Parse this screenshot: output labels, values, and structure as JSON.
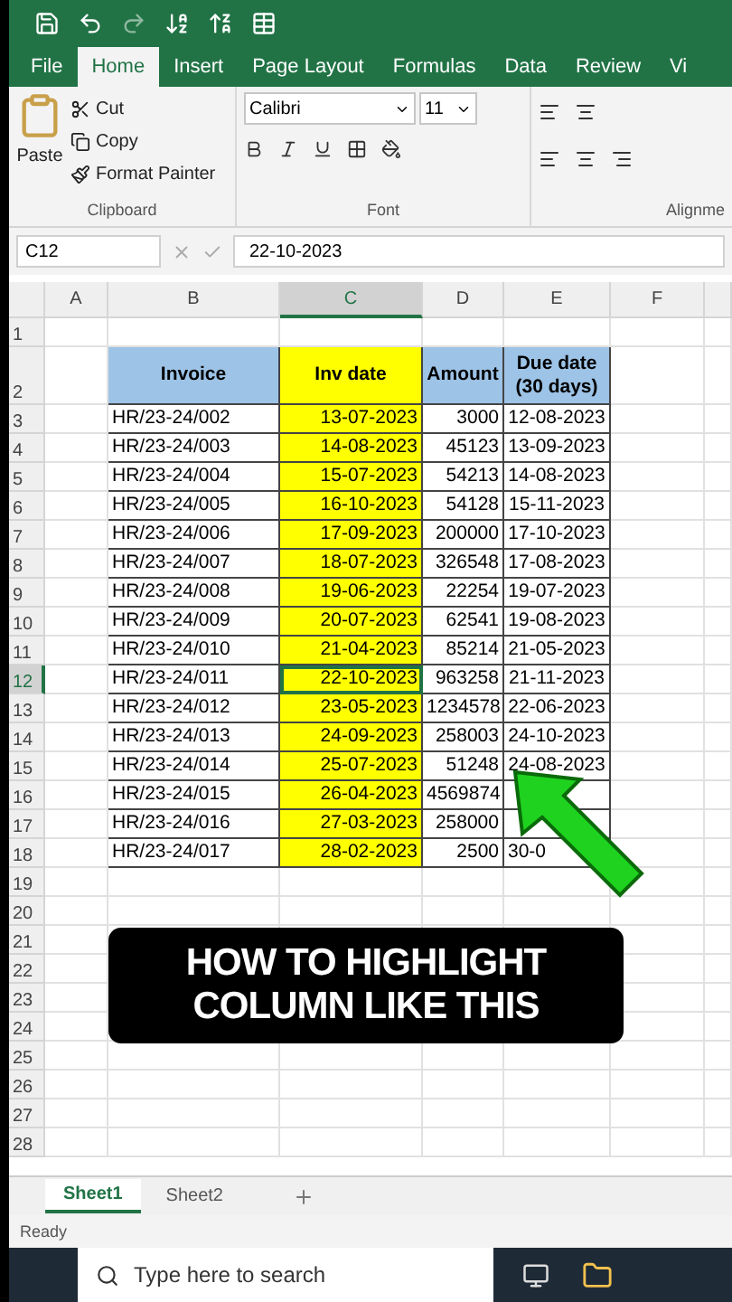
{
  "tabs": [
    {
      "label": "File",
      "selected": false
    },
    {
      "label": "Home",
      "selected": true
    },
    {
      "label": "Insert",
      "selected": false
    },
    {
      "label": "Page Layout",
      "selected": false
    },
    {
      "label": "Formulas",
      "selected": false
    },
    {
      "label": "Data",
      "selected": false
    },
    {
      "label": "Review",
      "selected": false
    },
    {
      "label": "Vi",
      "selected": false
    }
  ],
  "ribbon": {
    "paste": "Paste",
    "cut": "Cut",
    "copy": "Copy",
    "format_painter": "Format Painter",
    "clipboard_label": "Clipboard",
    "font_name": "Calibri",
    "font_size": "11",
    "font_label": "Font",
    "alignment_label": "Alignme"
  },
  "formula_bar": {
    "name_box": "C12",
    "formula": "22-10-2023"
  },
  "columns": [
    {
      "label": "A",
      "selected": false
    },
    {
      "label": "B",
      "selected": false
    },
    {
      "label": "C",
      "selected": true
    },
    {
      "label": "D",
      "selected": false
    },
    {
      "label": "E",
      "selected": false
    },
    {
      "label": "F",
      "selected": false
    }
  ],
  "table": {
    "headers": [
      "Invoice",
      "Inv date",
      "Amount",
      "Due date\n(30 days)"
    ],
    "rows": [
      {
        "invoice": "HR/23-24/002",
        "date": "13-07-2023",
        "amount": "3000",
        "due": "12-08-2023",
        "selected": false
      },
      {
        "invoice": "HR/23-24/003",
        "date": "14-08-2023",
        "amount": "45123",
        "due": "13-09-2023",
        "selected": false
      },
      {
        "invoice": "HR/23-24/004",
        "date": "15-07-2023",
        "amount": "54213",
        "due": "14-08-2023",
        "selected": false
      },
      {
        "invoice": "HR/23-24/005",
        "date": "16-10-2023",
        "amount": "54128",
        "due": "15-11-2023",
        "selected": false
      },
      {
        "invoice": "HR/23-24/006",
        "date": "17-09-2023",
        "amount": "200000",
        "due": "17-10-2023",
        "selected": false
      },
      {
        "invoice": "HR/23-24/007",
        "date": "18-07-2023",
        "amount": "326548",
        "due": "17-08-2023",
        "selected": false
      },
      {
        "invoice": "HR/23-24/008",
        "date": "19-06-2023",
        "amount": "22254",
        "due": "19-07-2023",
        "selected": false
      },
      {
        "invoice": "HR/23-24/009",
        "date": "20-07-2023",
        "amount": "62541",
        "due": "19-08-2023",
        "selected": false
      },
      {
        "invoice": "HR/23-24/010",
        "date": "21-04-2023",
        "amount": "85214",
        "due": "21-05-2023",
        "selected": false
      },
      {
        "invoice": "HR/23-24/011",
        "date": "22-10-2023",
        "amount": "963258",
        "due": "21-11-2023",
        "selected": true
      },
      {
        "invoice": "HR/23-24/012",
        "date": "23-05-2023",
        "amount": "1234578",
        "due": "22-06-2023",
        "selected": false
      },
      {
        "invoice": "HR/23-24/013",
        "date": "24-09-2023",
        "amount": "258003",
        "due": "24-10-2023",
        "selected": false
      },
      {
        "invoice": "HR/23-24/014",
        "date": "25-07-2023",
        "amount": "51248",
        "due": "24-08-2023",
        "selected": false
      },
      {
        "invoice": "HR/23-24/015",
        "date": "26-04-2023",
        "amount": "4569874",
        "selected": false
      },
      {
        "invoice": "HR/23-24/016",
        "date": "27-03-2023",
        "amount": "258000",
        "selected": false
      },
      {
        "invoice": "HR/23-24/017",
        "date": "28-02-2023",
        "amount": "2500",
        "due": "30-0",
        "selected": false
      }
    ]
  },
  "row_numbers": [
    "1",
    "2",
    "3",
    "4",
    "5",
    "6",
    "7",
    "8",
    "9",
    "10",
    "11",
    "12",
    "13",
    "14",
    "15",
    "16",
    "17",
    "18",
    "19",
    "20",
    "21",
    "22",
    "23",
    "24",
    "25",
    "26",
    "27",
    "28"
  ],
  "caption": [
    "HOW TO HIGHLIGHT",
    "COLUMN LIKE THIS"
  ],
  "sheets": [
    {
      "label": "Sheet1",
      "selected": true
    },
    {
      "label": "Sheet2",
      "selected": false
    }
  ],
  "status": "Ready",
  "taskbar": {
    "search_placeholder": "Type here to search"
  }
}
